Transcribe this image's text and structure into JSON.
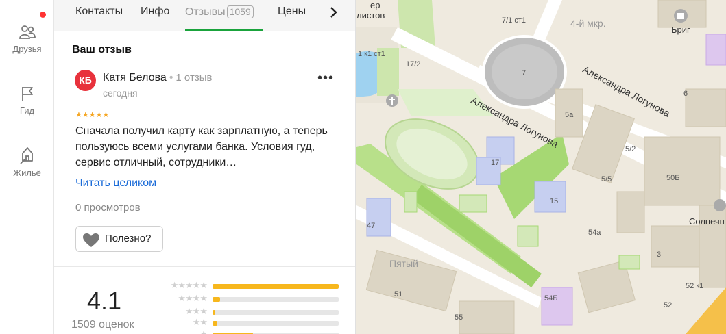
{
  "rail": {
    "items": [
      {
        "label": "Друзья",
        "icon": "friends-icon",
        "badge": true
      },
      {
        "label": "Гид",
        "icon": "flag-icon"
      },
      {
        "label": "Жильё",
        "icon": "housing-icon"
      }
    ]
  },
  "tabs": {
    "items": [
      "Контакты",
      "Инфо",
      "Отзывы",
      "Цены"
    ],
    "reviews_count": "1059",
    "next_icon": "chevron-right-icon"
  },
  "review": {
    "section_title": "Ваш отзыв",
    "avatar_initials": "КБ",
    "author": "Катя Белова",
    "author_reviews": "1 отзыв",
    "date": "сегодня",
    "stars": "★★★★★",
    "text": "Сначала получил карту как зарплатную, а теперь пользуюсь всеми услугами банка. Условия гуд, сервис отличный, сотрудники…",
    "read_more": "Читать целиком",
    "views": "0 просмотров",
    "useful_label": "Полезно?",
    "more_label": "•••"
  },
  "rating": {
    "value": "4.1",
    "count_label": "1509 оценок",
    "distribution": [
      {
        "stars": "★★★★★",
        "fraction": 1.0
      },
      {
        "stars": "★★★★",
        "fraction": 0.06
      },
      {
        "stars": "★★★",
        "fraction": 0.02
      },
      {
        "stars": "★★",
        "fraction": 0.04
      },
      {
        "stars": "★",
        "fraction": 0.32
      }
    ]
  },
  "map": {
    "streets": [
      "Александра Логунова",
      "Александра Логунова"
    ],
    "district_4": "4-й мкр.",
    "district_5": "Пятый",
    "brig": "Бриг",
    "solnechny": "Солнечн",
    "top_street": "ер",
    "top_street2": "листов",
    "houses": [
      "7/1 ст1",
      "7",
      "5а",
      "17/2",
      "1 к1 ст1",
      "17",
      "15",
      "5/2",
      "5/5",
      "50Б",
      "6",
      "47",
      "54а",
      "3",
      "52 к1",
      "51",
      "54Б",
      "52",
      "55"
    ]
  }
}
